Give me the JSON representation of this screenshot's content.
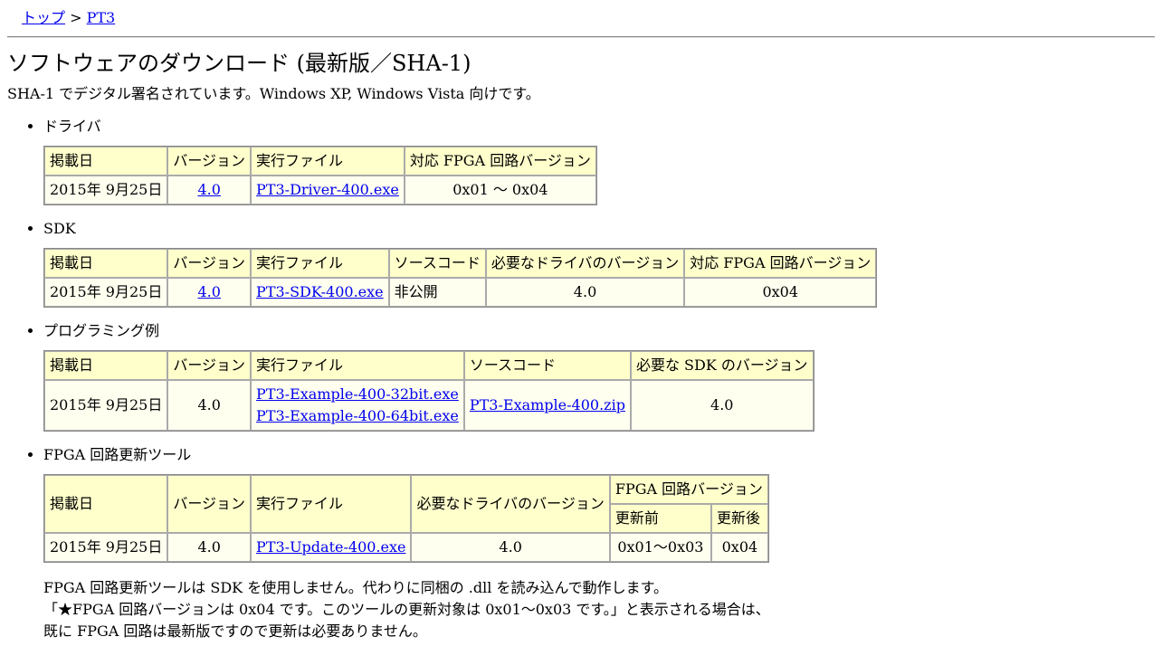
{
  "breadcrumb": {
    "top": "トップ",
    "sep": " > ",
    "current": "PT3"
  },
  "title": "ソフトウェアのダウンロード (最新版／SHA-1)",
  "intro": "SHA-1 でデジタル署名されています。Windows XP, Windows Vista 向けです。",
  "driver": {
    "heading": "ドライバ",
    "headers": [
      "掲載日",
      "バージョン",
      "実行ファイル",
      "対応 FPGA 回路バージョン"
    ],
    "row": {
      "date": "2015年 9月25日",
      "version": "4.0",
      "file": "PT3-Driver-400.exe",
      "fpga": "0x01 ～ 0x04"
    }
  },
  "sdk": {
    "heading": "SDK",
    "headers": [
      "掲載日",
      "バージョン",
      "実行ファイル",
      "ソースコード",
      "必要なドライバのバージョン",
      "対応 FPGA 回路バージョン"
    ],
    "row": {
      "date": "2015年 9月25日",
      "version": "4.0",
      "file": "PT3-SDK-400.exe",
      "source": "非公開",
      "driver": "4.0",
      "fpga": "0x04"
    }
  },
  "example": {
    "heading": "プログラミング例",
    "headers": [
      "掲載日",
      "バージョン",
      "実行ファイル",
      "ソースコード",
      "必要な SDK のバージョン"
    ],
    "row": {
      "date": "2015年 9月25日",
      "version": "4.0",
      "file32": "PT3-Example-400-32bit.exe",
      "file64": "PT3-Example-400-64bit.exe",
      "source": "PT3-Example-400.zip",
      "sdk": "4.0"
    }
  },
  "update": {
    "heading": "FPGA 回路更新ツール",
    "headers": [
      "掲載日",
      "バージョン",
      "実行ファイル",
      "必要なドライバのバージョン",
      "FPGA 回路バージョン"
    ],
    "subheaders": [
      "更新前",
      "更新後"
    ],
    "row": {
      "date": "2015年 9月25日",
      "version": "4.0",
      "file": "PT3-Update-400.exe",
      "driver": "4.0",
      "before": "0x01～0x03",
      "after": "0x04"
    }
  },
  "notes": [
    "FPGA 回路更新ツールは SDK を使用しません。代わりに同梱の .dll を読み込んで動作します。",
    "「★FPGA 回路バージョンは 0x04 です。このツールの更新対象は 0x01～0x03 です。」と表示される場合は、",
    "既に FPGA 回路は最新版ですので更新は必要ありません。"
  ]
}
